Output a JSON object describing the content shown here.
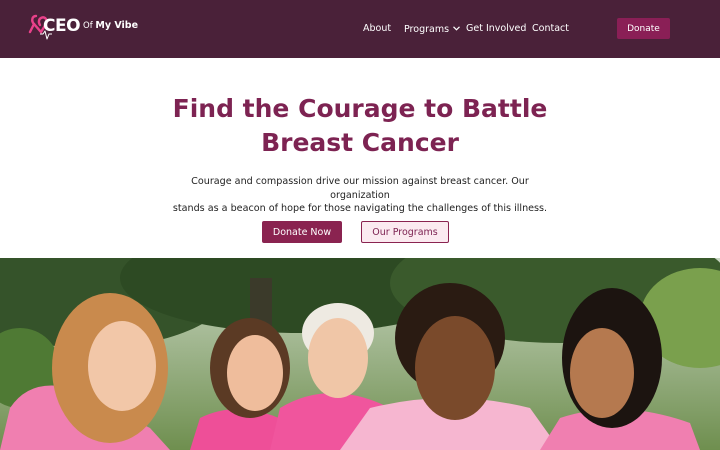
{
  "brand": {
    "logo_main": "CEO",
    "logo_of": "Of",
    "logo_tail": "My Vibe",
    "header_bg": "#4a2139",
    "accent": "#8a1f56"
  },
  "nav": {
    "about": "About",
    "programs": "Programs",
    "get_involved": "Get Involved",
    "contact": "Contact",
    "donate": "Donate"
  },
  "hero": {
    "title_line1": "Find the Courage to Battle",
    "title_line2": "Breast Cancer",
    "text_line1": "Courage and compassion drive our mission against breast cancer. Our organization",
    "text_line2": "stands as a beacon of hope for those navigating the challenges of this illness.",
    "primary_button": "Donate Now",
    "secondary_button": "Our Programs"
  },
  "icons": {
    "ribbon": "pink-ribbon-heartbeat-icon",
    "dropdown": "chevron-down-icon"
  }
}
